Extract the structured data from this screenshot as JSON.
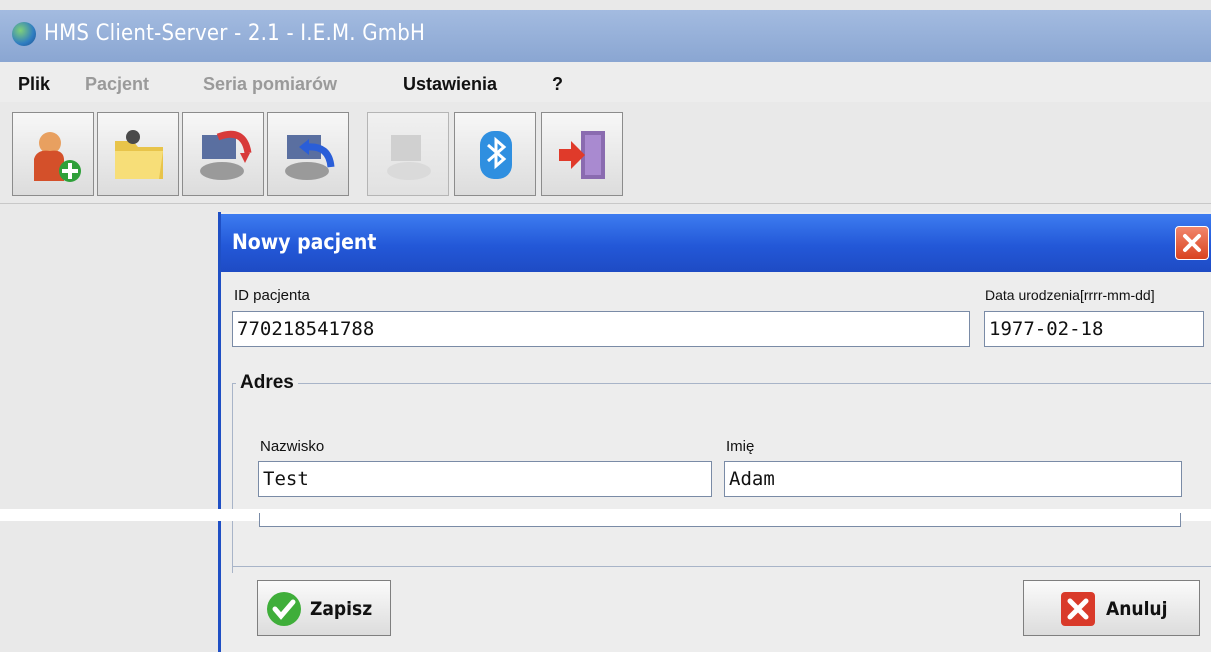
{
  "window": {
    "title": "HMS Client-Server - 2.1 - I.E.M. GmbH"
  },
  "menu": {
    "items": [
      {
        "label": "Plik",
        "enabled": true
      },
      {
        "label": "Pacjent",
        "enabled": false
      },
      {
        "label": "Seria pomiarów",
        "enabled": false
      },
      {
        "label": "Ustawienia",
        "enabled": true
      },
      {
        "label": "?",
        "enabled": true
      }
    ]
  },
  "toolbar": {
    "buttons": [
      {
        "icon": "add-patient-icon",
        "enabled": true
      },
      {
        "icon": "open-folder-icon",
        "enabled": true
      },
      {
        "icon": "device-download-icon",
        "enabled": true
      },
      {
        "icon": "device-upload-icon",
        "enabled": true
      },
      {
        "icon": "device-icon",
        "enabled": false
      },
      {
        "icon": "bluetooth-icon",
        "enabled": true
      },
      {
        "icon": "exit-door-icon",
        "enabled": true
      }
    ]
  },
  "dialog": {
    "title": "Nowy pacjent",
    "patient_id_label": "ID pacjenta",
    "patient_id_value": "770218541788",
    "birth_date_label": "Data urodzenia[rrrr-mm-dd]",
    "birth_date_value": "1977-02-18",
    "address_legend": "Adres",
    "surname_label": "Nazwisko",
    "surname_value": "Test",
    "firstname_label": "Imię",
    "firstname_value": "Adam",
    "save_label": "Zapisz",
    "cancel_label": "Anuluj"
  },
  "colors": {
    "dialog_title_bar": "#2358d8",
    "main_title_bar": "#8aa6d2"
  }
}
